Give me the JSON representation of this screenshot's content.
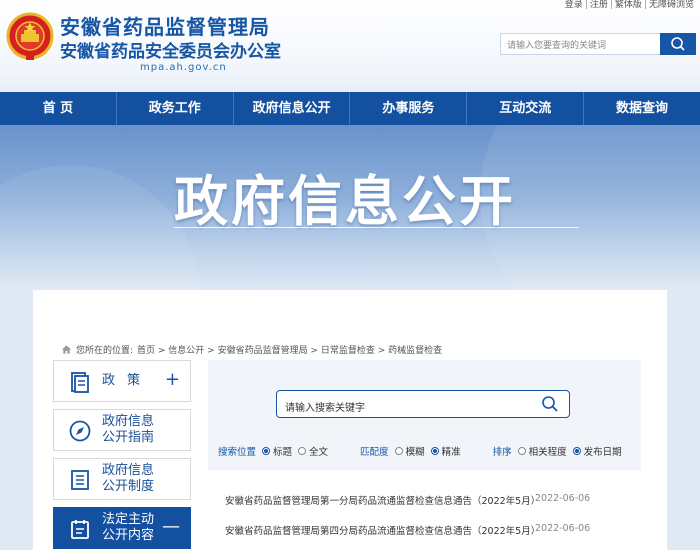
{
  "header": {
    "title_main": "安徽省药品监督管理局",
    "title_sub": "安徽省药品安全委员会办公室",
    "domain": "mpa.ah.gov.cn",
    "top_links": [
      "登录",
      "注册",
      "繁体版",
      "无障碍浏览"
    ],
    "search_placeholder": "请输入您要查询的关键词"
  },
  "nav": {
    "items": [
      {
        "label": "首 页"
      },
      {
        "label": "政务工作"
      },
      {
        "label": "政府信息公开"
      },
      {
        "label": "办事服务"
      },
      {
        "label": "互动交流"
      },
      {
        "label": "数据查询"
      }
    ]
  },
  "banner": {
    "title": "政府信息公开"
  },
  "breadcrumb": {
    "prefix": "您所在的位置:",
    "path": "首页 > 信息公开 > 安徽省药品监督管理局 > 日常监督检查 > 药械监督检查"
  },
  "sidebar": {
    "items": [
      {
        "line1": "政策",
        "line2": "",
        "mark": "+",
        "active": false,
        "icon": "document-icon"
      },
      {
        "line1": "政府信息",
        "line2": "公开指南",
        "mark": "",
        "active": false,
        "icon": "compass-icon"
      },
      {
        "line1": "政府信息",
        "line2": "公开制度",
        "mark": "",
        "active": false,
        "icon": "list-icon"
      },
      {
        "line1": "法定主动",
        "line2": "公开内容",
        "mark": "—",
        "active": true,
        "icon": "calendar-icon"
      }
    ]
  },
  "panel": {
    "search_placeholder": "请输入搜索关键字",
    "filters": {
      "location_label": "搜索位置",
      "location_options": [
        "标题",
        "全文"
      ],
      "match_label": "匹配度",
      "match_options": [
        "模糊",
        "精准"
      ],
      "sort_label": "排序",
      "sort_options": [
        "相关程度",
        "发布日期"
      ]
    }
  },
  "results": [
    {
      "title": "安徽省药品监督管理局第一分局药品流通监督检查信息通告（2022年5月）",
      "date": "2022-06-06"
    },
    {
      "title": "安徽省药品监督管理局第四分局药品流通监督检查信息通告（2022年5月）",
      "date": "2022-06-06"
    }
  ],
  "colors": {
    "primary": "#1450a0",
    "title_blue": "#1656a5"
  }
}
